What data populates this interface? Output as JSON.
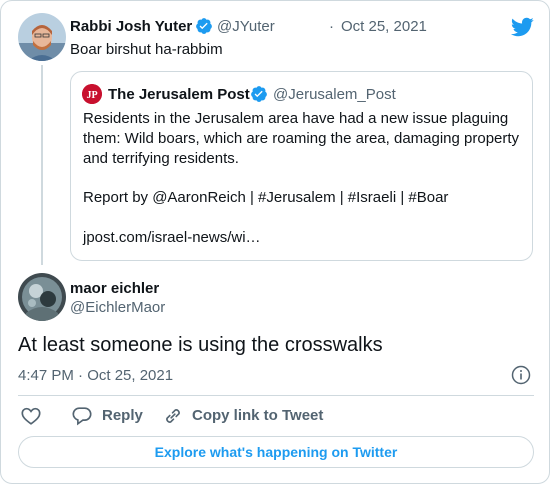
{
  "parent_tweet": {
    "author_name": "Rabbi Josh Yuter",
    "author_handle": "@JYuter",
    "separator": "·",
    "date": "Oct 25, 2021",
    "text": "Boar birshut ha-rabbim"
  },
  "quoted_tweet": {
    "author_name": "The Jerusalem Post",
    "author_handle": "@Jerusalem_Post",
    "text_lines": [
      "Residents in the Jerusalem area have had a new issue plaguing",
      "them: Wild boars, which are roaming the area, damaging property",
      "and terrifying residents."
    ],
    "report_line": "Report by @AaronReich | #Jerusalem | #Israeli | #Boar",
    "link": "jpost.com/israel-news/wi…",
    "logo_letters": "JP"
  },
  "main_tweet": {
    "author_name": "maor eichler",
    "author_handle": "@EichlerMaor",
    "text": "At least someone is using the crosswalks",
    "timestamp": "4:47 PM · Oct 25, 2021"
  },
  "actions": {
    "reply_label": "Reply",
    "copy_link_label": "Copy link to Tweet"
  },
  "footer": {
    "explore_label": "Explore what's happening on Twitter"
  },
  "colors": {
    "accent": "#1d9bf0",
    "secondary_text": "#536471",
    "border": "#cfd9de",
    "jpost_red": "#c8102e"
  },
  "icons": [
    "twitter-bird-icon",
    "verified-badge-icon",
    "info-icon",
    "heart-icon",
    "reply-icon",
    "link-icon"
  ]
}
